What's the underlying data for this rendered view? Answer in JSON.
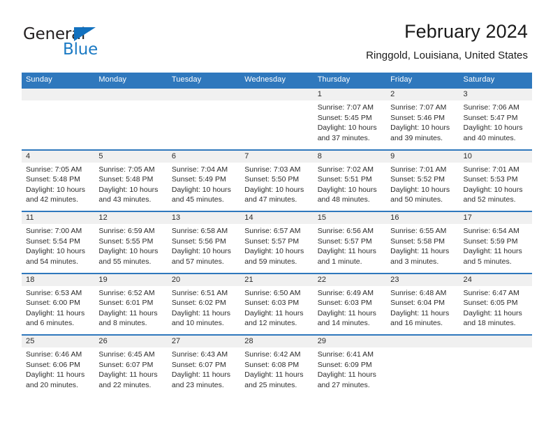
{
  "brand": {
    "name_part1": "General",
    "name_part2": "Blue",
    "accent_color": "#1b7ac4"
  },
  "header": {
    "title": "February 2024",
    "subtitle": "Ringgold, Louisiana, United States"
  },
  "calendar": {
    "header_bg": "#2f78bd",
    "row_band_bg": "#f0f0f0",
    "weekdays": [
      "Sunday",
      "Monday",
      "Tuesday",
      "Wednesday",
      "Thursday",
      "Friday",
      "Saturday"
    ],
    "weeks": [
      [
        {
          "day": "",
          "sunrise": "",
          "sunset": "",
          "daylight1": "",
          "daylight2": ""
        },
        {
          "day": "",
          "sunrise": "",
          "sunset": "",
          "daylight1": "",
          "daylight2": ""
        },
        {
          "day": "",
          "sunrise": "",
          "sunset": "",
          "daylight1": "",
          "daylight2": ""
        },
        {
          "day": "",
          "sunrise": "",
          "sunset": "",
          "daylight1": "",
          "daylight2": ""
        },
        {
          "day": "1",
          "sunrise": "Sunrise: 7:07 AM",
          "sunset": "Sunset: 5:45 PM",
          "daylight1": "Daylight: 10 hours",
          "daylight2": "and 37 minutes."
        },
        {
          "day": "2",
          "sunrise": "Sunrise: 7:07 AM",
          "sunset": "Sunset: 5:46 PM",
          "daylight1": "Daylight: 10 hours",
          "daylight2": "and 39 minutes."
        },
        {
          "day": "3",
          "sunrise": "Sunrise: 7:06 AM",
          "sunset": "Sunset: 5:47 PM",
          "daylight1": "Daylight: 10 hours",
          "daylight2": "and 40 minutes."
        }
      ],
      [
        {
          "day": "4",
          "sunrise": "Sunrise: 7:05 AM",
          "sunset": "Sunset: 5:48 PM",
          "daylight1": "Daylight: 10 hours",
          "daylight2": "and 42 minutes."
        },
        {
          "day": "5",
          "sunrise": "Sunrise: 7:05 AM",
          "sunset": "Sunset: 5:48 PM",
          "daylight1": "Daylight: 10 hours",
          "daylight2": "and 43 minutes."
        },
        {
          "day": "6",
          "sunrise": "Sunrise: 7:04 AM",
          "sunset": "Sunset: 5:49 PM",
          "daylight1": "Daylight: 10 hours",
          "daylight2": "and 45 minutes."
        },
        {
          "day": "7",
          "sunrise": "Sunrise: 7:03 AM",
          "sunset": "Sunset: 5:50 PM",
          "daylight1": "Daylight: 10 hours",
          "daylight2": "and 47 minutes."
        },
        {
          "day": "8",
          "sunrise": "Sunrise: 7:02 AM",
          "sunset": "Sunset: 5:51 PM",
          "daylight1": "Daylight: 10 hours",
          "daylight2": "and 48 minutes."
        },
        {
          "day": "9",
          "sunrise": "Sunrise: 7:01 AM",
          "sunset": "Sunset: 5:52 PM",
          "daylight1": "Daylight: 10 hours",
          "daylight2": "and 50 minutes."
        },
        {
          "day": "10",
          "sunrise": "Sunrise: 7:01 AM",
          "sunset": "Sunset: 5:53 PM",
          "daylight1": "Daylight: 10 hours",
          "daylight2": "and 52 minutes."
        }
      ],
      [
        {
          "day": "11",
          "sunrise": "Sunrise: 7:00 AM",
          "sunset": "Sunset: 5:54 PM",
          "daylight1": "Daylight: 10 hours",
          "daylight2": "and 54 minutes."
        },
        {
          "day": "12",
          "sunrise": "Sunrise: 6:59 AM",
          "sunset": "Sunset: 5:55 PM",
          "daylight1": "Daylight: 10 hours",
          "daylight2": "and 55 minutes."
        },
        {
          "day": "13",
          "sunrise": "Sunrise: 6:58 AM",
          "sunset": "Sunset: 5:56 PM",
          "daylight1": "Daylight: 10 hours",
          "daylight2": "and 57 minutes."
        },
        {
          "day": "14",
          "sunrise": "Sunrise: 6:57 AM",
          "sunset": "Sunset: 5:57 PM",
          "daylight1": "Daylight: 10 hours",
          "daylight2": "and 59 minutes."
        },
        {
          "day": "15",
          "sunrise": "Sunrise: 6:56 AM",
          "sunset": "Sunset: 5:57 PM",
          "daylight1": "Daylight: 11 hours",
          "daylight2": "and 1 minute."
        },
        {
          "day": "16",
          "sunrise": "Sunrise: 6:55 AM",
          "sunset": "Sunset: 5:58 PM",
          "daylight1": "Daylight: 11 hours",
          "daylight2": "and 3 minutes."
        },
        {
          "day": "17",
          "sunrise": "Sunrise: 6:54 AM",
          "sunset": "Sunset: 5:59 PM",
          "daylight1": "Daylight: 11 hours",
          "daylight2": "and 5 minutes."
        }
      ],
      [
        {
          "day": "18",
          "sunrise": "Sunrise: 6:53 AM",
          "sunset": "Sunset: 6:00 PM",
          "daylight1": "Daylight: 11 hours",
          "daylight2": "and 6 minutes."
        },
        {
          "day": "19",
          "sunrise": "Sunrise: 6:52 AM",
          "sunset": "Sunset: 6:01 PM",
          "daylight1": "Daylight: 11 hours",
          "daylight2": "and 8 minutes."
        },
        {
          "day": "20",
          "sunrise": "Sunrise: 6:51 AM",
          "sunset": "Sunset: 6:02 PM",
          "daylight1": "Daylight: 11 hours",
          "daylight2": "and 10 minutes."
        },
        {
          "day": "21",
          "sunrise": "Sunrise: 6:50 AM",
          "sunset": "Sunset: 6:03 PM",
          "daylight1": "Daylight: 11 hours",
          "daylight2": "and 12 minutes."
        },
        {
          "day": "22",
          "sunrise": "Sunrise: 6:49 AM",
          "sunset": "Sunset: 6:03 PM",
          "daylight1": "Daylight: 11 hours",
          "daylight2": "and 14 minutes."
        },
        {
          "day": "23",
          "sunrise": "Sunrise: 6:48 AM",
          "sunset": "Sunset: 6:04 PM",
          "daylight1": "Daylight: 11 hours",
          "daylight2": "and 16 minutes."
        },
        {
          "day": "24",
          "sunrise": "Sunrise: 6:47 AM",
          "sunset": "Sunset: 6:05 PM",
          "daylight1": "Daylight: 11 hours",
          "daylight2": "and 18 minutes."
        }
      ],
      [
        {
          "day": "25",
          "sunrise": "Sunrise: 6:46 AM",
          "sunset": "Sunset: 6:06 PM",
          "daylight1": "Daylight: 11 hours",
          "daylight2": "and 20 minutes."
        },
        {
          "day": "26",
          "sunrise": "Sunrise: 6:45 AM",
          "sunset": "Sunset: 6:07 PM",
          "daylight1": "Daylight: 11 hours",
          "daylight2": "and 22 minutes."
        },
        {
          "day": "27",
          "sunrise": "Sunrise: 6:43 AM",
          "sunset": "Sunset: 6:07 PM",
          "daylight1": "Daylight: 11 hours",
          "daylight2": "and 23 minutes."
        },
        {
          "day": "28",
          "sunrise": "Sunrise: 6:42 AM",
          "sunset": "Sunset: 6:08 PM",
          "daylight1": "Daylight: 11 hours",
          "daylight2": "and 25 minutes."
        },
        {
          "day": "29",
          "sunrise": "Sunrise: 6:41 AM",
          "sunset": "Sunset: 6:09 PM",
          "daylight1": "Daylight: 11 hours",
          "daylight2": "and 27 minutes."
        },
        {
          "day": "",
          "sunrise": "",
          "sunset": "",
          "daylight1": "",
          "daylight2": ""
        },
        {
          "day": "",
          "sunrise": "",
          "sunset": "",
          "daylight1": "",
          "daylight2": ""
        }
      ]
    ]
  }
}
